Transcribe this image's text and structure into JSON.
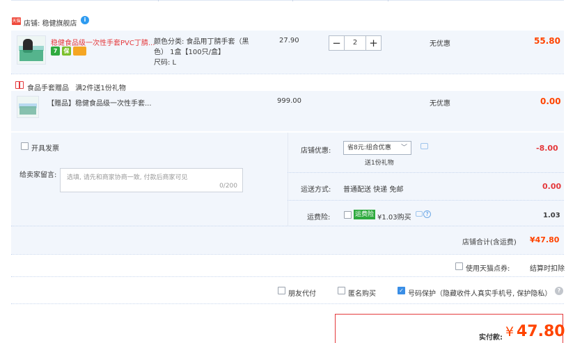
{
  "shop": {
    "tag_text": "天猫",
    "label": "店铺:",
    "name": "稳健旗舰店",
    "badge": "i"
  },
  "item": {
    "title": "稳健食品级一次性手套PVC丁腈...",
    "sku_color": "颜色分类: 食品用丁腈手套（黑",
    "sku_color2": "色） 1盒【100只/盒】",
    "sku_size": "尺码: L",
    "unit_price": "27.90",
    "qty": "2",
    "minus": "−",
    "plus": "+",
    "discount": "无优惠",
    "subtotal": "55.80",
    "icon_seven": "7",
    "icon_shield": "保"
  },
  "gift_section": {
    "header": "食品手套赠品",
    "rule": "满2件送1份礼物",
    "title": "【赠品】稳健食品级一次性手套...",
    "price": "999.00",
    "discount": "无优惠",
    "subtotal": "0.00"
  },
  "options": {
    "invoice_label": "开具发票",
    "message_label": "给卖家留言:",
    "message_placeholder": "选填, 请先和商家协商一致, 付款后商家可见",
    "message_count": "0/200",
    "shop_discount_label": "店铺优惠:",
    "shop_discount_select": "省8元:组合优惠",
    "shop_discount_note": "送1份礼物",
    "shop_discount_value": "-8.00",
    "shipping_label": "运送方式:",
    "shipping_value": "普通配送 快递 免邮",
    "shipping_fee": "0.00",
    "insurance_label": "运费险:",
    "insurance_badge": "运费险",
    "insurance_text": "¥1.03购买",
    "insurance_value": "1.03",
    "shop_total_label": "店铺合计(含运费)",
    "shop_total_value": "¥47.80"
  },
  "points": {
    "label": "使用天猫点券:",
    "value": "结算时扣除"
  },
  "footer_opts": {
    "friend_pay": "朋友代付",
    "anonymous": "匿名购买",
    "phone_protect": "号码保护（隐藏收件人真实手机号, 保护隐私）"
  },
  "final": {
    "label": "实付款:",
    "currency": "¥",
    "amount": "47.80"
  },
  "colors": {
    "accent": "#ff4400",
    "link": "#e4393c",
    "check": "#3a8ee6"
  }
}
